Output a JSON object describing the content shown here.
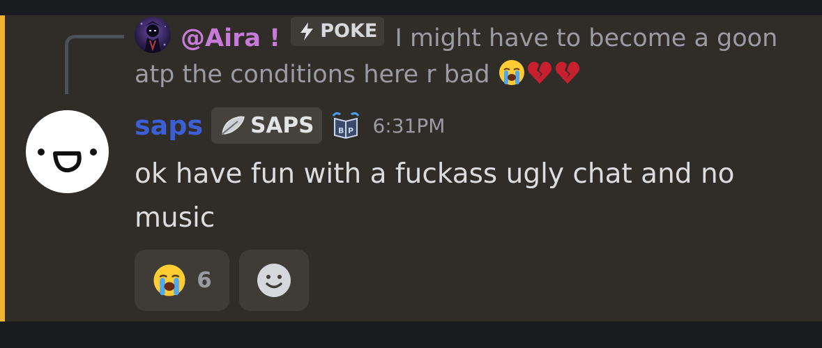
{
  "theme": {
    "mention_bar": "#f0b232",
    "message_bg": "#302d28",
    "reply_name_color": "#c57bd7",
    "author_name_color": "#3d5fd6",
    "text_color": "#dcddde",
    "muted_color": "#9b9ca3"
  },
  "reply": {
    "author": "@Aira !",
    "tag_icon": "lightning-icon",
    "tag_label": "POKE",
    "text": "I might have to become a goon atp the conditions here r bad",
    "emojis": [
      "loudly-crying-face-icon",
      "broken-heart-icon",
      "broken-heart-icon"
    ]
  },
  "message": {
    "author": "saps",
    "role_icon": "feather-icon",
    "role_label": "SAPS",
    "badge_icon": "bp-book-icon",
    "timestamp": "6:31PM",
    "text": "ok have fun with a fuckass ugly chat and no music"
  },
  "reactions": [
    {
      "emoji": "loudly-crying-face-icon",
      "count": "6"
    }
  ],
  "add_reaction_icon": "smiley-face-icon"
}
